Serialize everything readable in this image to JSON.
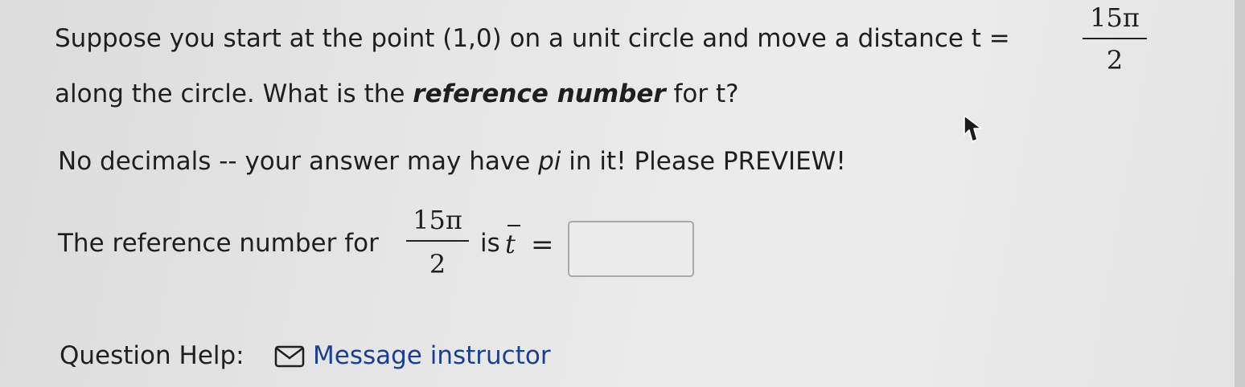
{
  "question": {
    "line1": "Suppose you start at the point (1,0) on a unit circle and move a distance t =",
    "t_numerator": "15π",
    "t_denominator": "2",
    "line2_before": "along the circle. What is the ",
    "line2_emphasis": "reference number",
    "line2_after": " for t?",
    "line3_before": "No decimals -- your answer may have ",
    "line3_emphasis": "pi",
    "line3_after": " in it! Please PREVIEW!"
  },
  "answer_prompt": {
    "before": "The reference number for",
    "frac_numerator": "15π",
    "frac_denominator": "2",
    "is": "is",
    "variable": "t",
    "equals": "=",
    "input_value": ""
  },
  "help": {
    "label": "Question Help:",
    "message_link": "Message instructor",
    "message_icon": "envelope-icon"
  },
  "cursor_icon": "mouse-pointer-icon"
}
